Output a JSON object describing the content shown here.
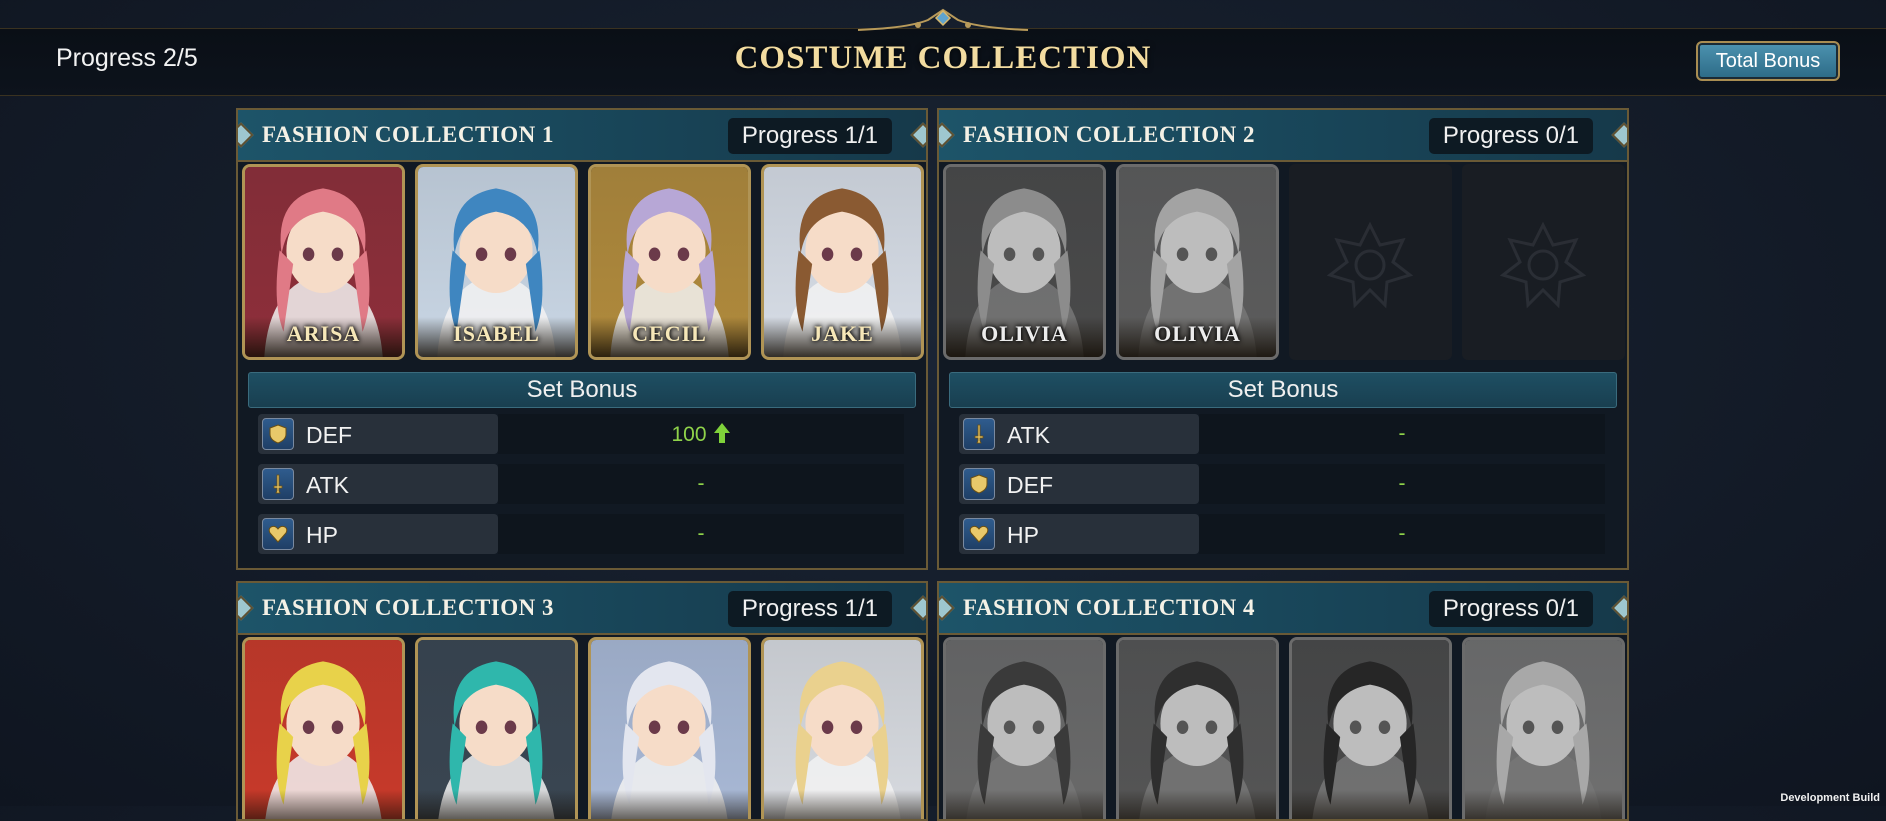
{
  "header": {
    "title": "COSTUME COLLECTION",
    "progress": "Progress 2/5",
    "total_bonus_label": "Total Bonus"
  },
  "panels": [
    {
      "title": "FASHION COLLECTION 1",
      "progress": "Progress 1/1",
      "cards": [
        {
          "name": "ARISA",
          "state": "color",
          "hair": "#e07a86",
          "bg": "#8e2f3a"
        },
        {
          "name": "ISABEL",
          "state": "color",
          "hair": "#3f86c0",
          "bg": "#c9d6e4"
        },
        {
          "name": "CECIL",
          "state": "color",
          "hair": "#b7a7d6",
          "bg": "#b08a3c"
        },
        {
          "name": "JAKE",
          "state": "color",
          "hair": "#8a5a32",
          "bg": "#d7dde6"
        }
      ],
      "set_bonus_label": "Set Bonus",
      "stats": [
        {
          "icon": "shield-icon",
          "label": "DEF",
          "value": "100",
          "arrow": true
        },
        {
          "icon": "sword-icon",
          "label": "ATK",
          "value": "-",
          "arrow": false
        },
        {
          "icon": "heart-icon",
          "label": "HP",
          "value": "-",
          "arrow": false
        }
      ]
    },
    {
      "title": "FASHION COLLECTION 2",
      "progress": "Progress 0/1",
      "cards": [
        {
          "name": "OLIVIA",
          "state": "gray",
          "hair": "#8c8c8c",
          "bg": "#4a4a4a"
        },
        {
          "name": "OLIVIA",
          "state": "gray",
          "hair": "#a3a3a3",
          "bg": "#5c5c5c"
        },
        {
          "name": "",
          "state": "empty"
        },
        {
          "name": "",
          "state": "empty"
        }
      ],
      "set_bonus_label": "Set Bonus",
      "stats": [
        {
          "icon": "sword-icon",
          "label": "ATK",
          "value": "-",
          "arrow": false
        },
        {
          "icon": "shield-icon",
          "label": "DEF",
          "value": "-",
          "arrow": false
        },
        {
          "icon": "heart-icon",
          "label": "HP",
          "value": "-",
          "arrow": false
        }
      ]
    },
    {
      "title": "FASHION COLLECTION 3",
      "progress": "Progress 1/1",
      "cards": [
        {
          "name": "",
          "state": "color",
          "hair": "#e8d24a",
          "bg": "#c93a2a"
        },
        {
          "name": "",
          "state": "color",
          "hair": "#2fb7ac",
          "bg": "#3a4652"
        },
        {
          "name": "",
          "state": "color",
          "hair": "#e3e6ef",
          "bg": "#a9b9d6"
        },
        {
          "name": "",
          "state": "color",
          "hair": "#ead18e",
          "bg": "#d8dbe0"
        }
      ]
    },
    {
      "title": "FASHION COLLECTION 4",
      "progress": "Progress 0/1",
      "cards": [
        {
          "name": "",
          "state": "gray",
          "hair": "#3a3a3a",
          "bg": "#6a6a6a"
        },
        {
          "name": "",
          "state": "gray",
          "hair": "#2f2f2f",
          "bg": "#555555"
        },
        {
          "name": "",
          "state": "gray",
          "hair": "#262626",
          "bg": "#4a4a4a"
        },
        {
          "name": "",
          "state": "gray",
          "hair": "#a8a8a8",
          "bg": "#707070"
        }
      ]
    }
  ],
  "footer": {
    "dev_build": "Development Build"
  }
}
